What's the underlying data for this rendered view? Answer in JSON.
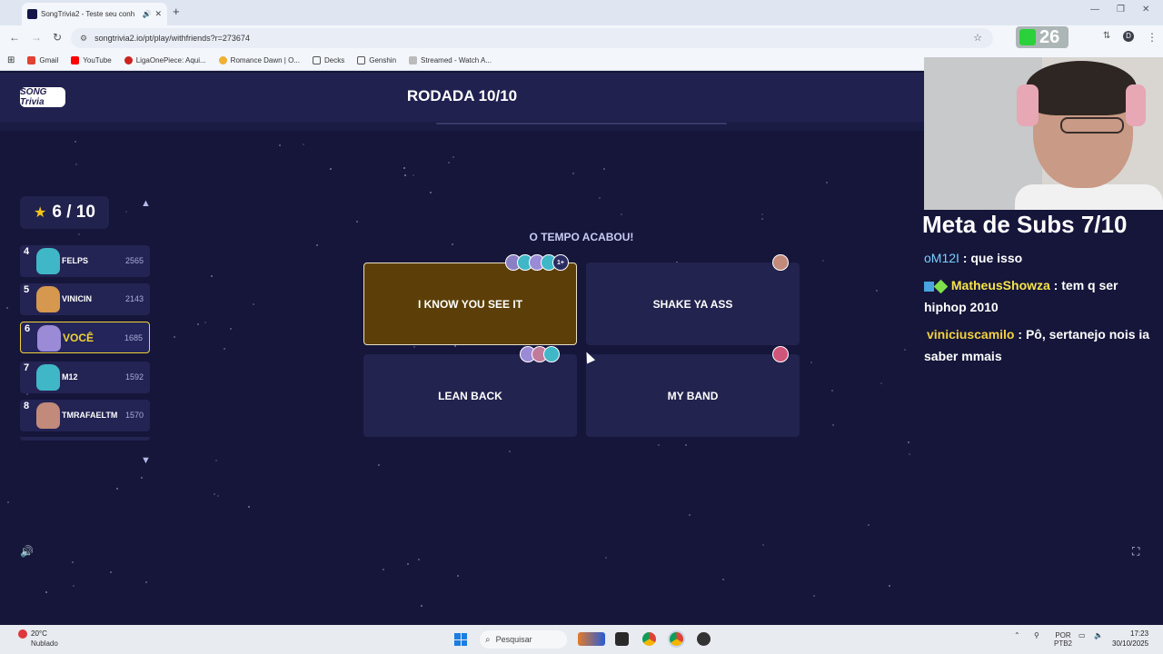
{
  "browser": {
    "tab_title": "SongTrivia2 - Teste seu conh",
    "url": "songtrivia2.io/pt/play/withfriends?r=273674",
    "bookmarks": [
      "Gmail",
      "YouTube",
      "LigaOnePiece: Aqui...",
      "Romance Dawn | O...",
      "Decks",
      "Genshin",
      "Streamed - Watch A..."
    ]
  },
  "game": {
    "logo": "SONG Trivia",
    "round_title": "RODADA 10/10",
    "score": "6 / 10",
    "time_up": "O TEMPO ACABOU!",
    "leaderboard": [
      {
        "rank": "4",
        "name": "FELPS",
        "score": "2565",
        "me": false,
        "color": "#3fb7c7"
      },
      {
        "rank": "5",
        "name": "VINICIN",
        "score": "2143",
        "me": false,
        "color": "#d6974e"
      },
      {
        "rank": "6",
        "name": "VOCÊ",
        "score": "1685",
        "me": true,
        "color": "#9b8ad6"
      },
      {
        "rank": "7",
        "name": "M12",
        "score": "1592",
        "me": false,
        "color": "#3fb7c7"
      },
      {
        "rank": "8",
        "name": "TMRAFAELTM",
        "score": "1570",
        "me": false,
        "color": "#c28a7a"
      }
    ],
    "answers": [
      {
        "text": "I KNOW YOU SEE IT",
        "correct": true,
        "voters_more": "1+"
      },
      {
        "text": "SHAKE YA ASS",
        "correct": false
      },
      {
        "text": "LEAN BACK",
        "correct": false
      },
      {
        "text": "MY BAND",
        "correct": false
      }
    ]
  },
  "stream": {
    "webcam_counter": "26",
    "meta_title": "Meta de Subs 7/10",
    "chat": [
      {
        "user": "oM12I",
        "message": "que isso"
      },
      {
        "user": "MatheusShowza",
        "message": "tem q ser hiphop 2010"
      },
      {
        "user": "viniciuscamilo",
        "message": "Pô, sertanejo nois ia saber mmais"
      }
    ]
  },
  "taskbar": {
    "temperature": "20°C",
    "weather": "Nublado",
    "search_placeholder": "Pesquisar",
    "lang": "POR",
    "lang2": "PTB2",
    "time": "17:23",
    "date": "30/10/2025"
  }
}
